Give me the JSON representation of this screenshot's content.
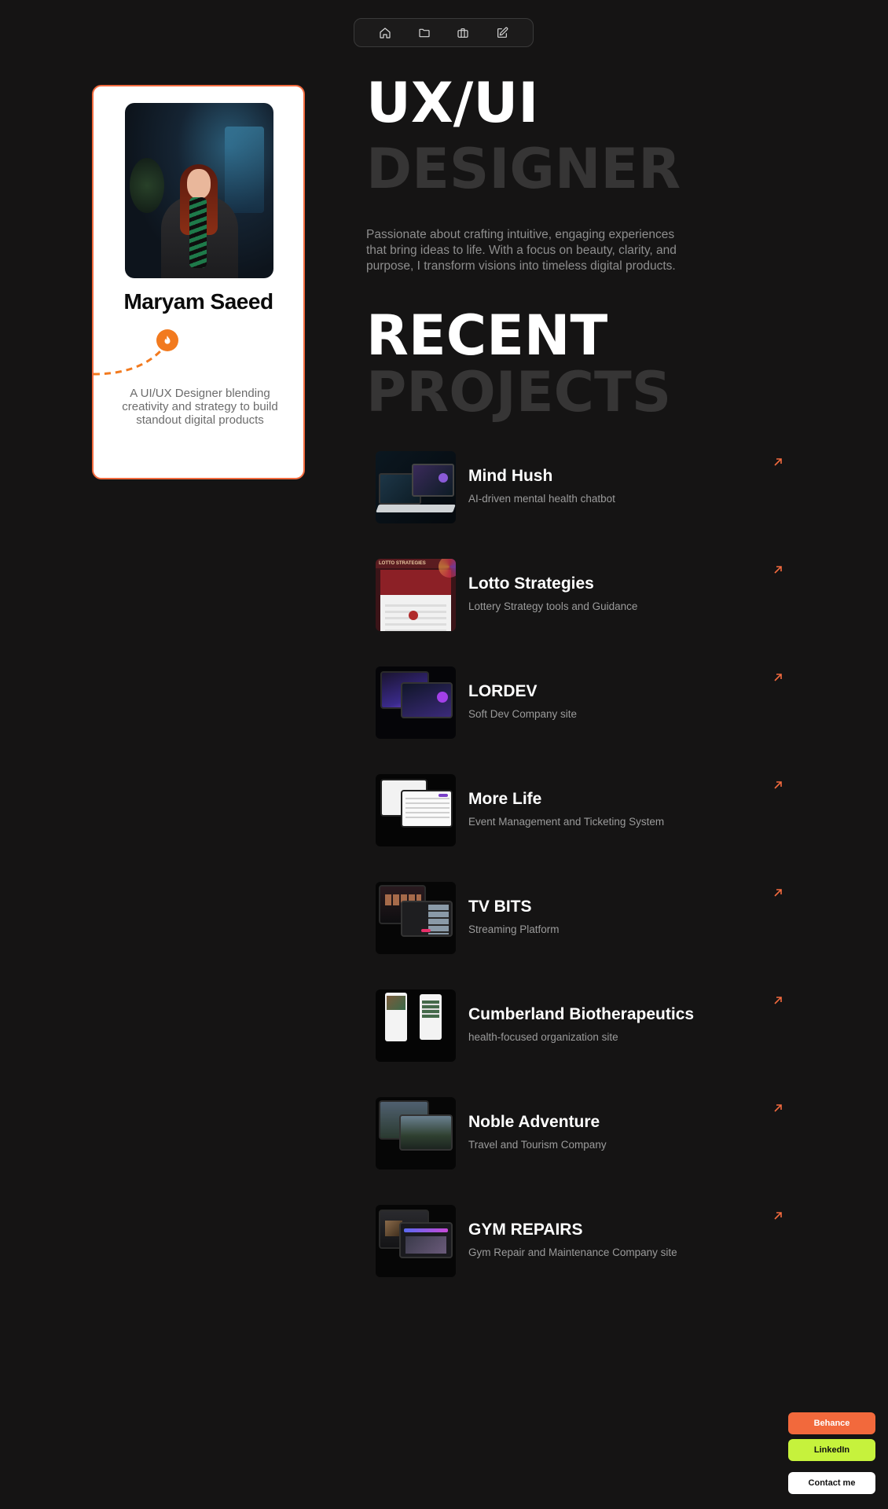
{
  "nav": {
    "items": [
      {
        "icon": "home-icon"
      },
      {
        "icon": "folder-icon"
      },
      {
        "icon": "briefcase-icon"
      },
      {
        "icon": "edit-icon"
      }
    ]
  },
  "profile": {
    "name": "Maryam Saeed",
    "tagline": "A UI/UX Designer blending creativity and strategy to build standout digital products",
    "badge_icon": "flame-icon",
    "accent_color": "#f26a3e"
  },
  "hero": {
    "title": "UX/UI",
    "subtitle": "DESIGNER",
    "intro": "Passionate about crafting intuitive, engaging experiences that bring ideas to life. With a focus on beauty, clarity, and purpose, I transform visions into timeless digital products."
  },
  "recent": {
    "title": "RECENT",
    "subtitle": "PROJECTS"
  },
  "projects": [
    {
      "title": "Mind Hush",
      "desc": "AI-driven mental health chatbot"
    },
    {
      "title": "Lotto Strategies",
      "desc": "Lottery Strategy tools and Guidance",
      "thumb_label": "LOTTO STRATEGIES"
    },
    {
      "title": "LORDEV",
      "desc": "Soft Dev Company site"
    },
    {
      "title": "More Life",
      "desc": "Event Management and Ticketing System"
    },
    {
      "title": "TV BITS",
      "desc": "Streaming Platform"
    },
    {
      "title": "Cumberland Biotherapeutics",
      "desc": "health-focused organization site"
    },
    {
      "title": "Noble Adventure",
      "desc": "Travel and Tourism Company"
    },
    {
      "title": "GYM REPAIRS",
      "desc": "Gym Repair and Maintenance Company site"
    }
  ],
  "cta": {
    "behance": "Behance",
    "linkedin": "LinkedIn",
    "contact": "Contact me",
    "colors": {
      "behance": "#f2693c",
      "linkedin": "#c6f23c",
      "contact": "#ffffff"
    }
  }
}
